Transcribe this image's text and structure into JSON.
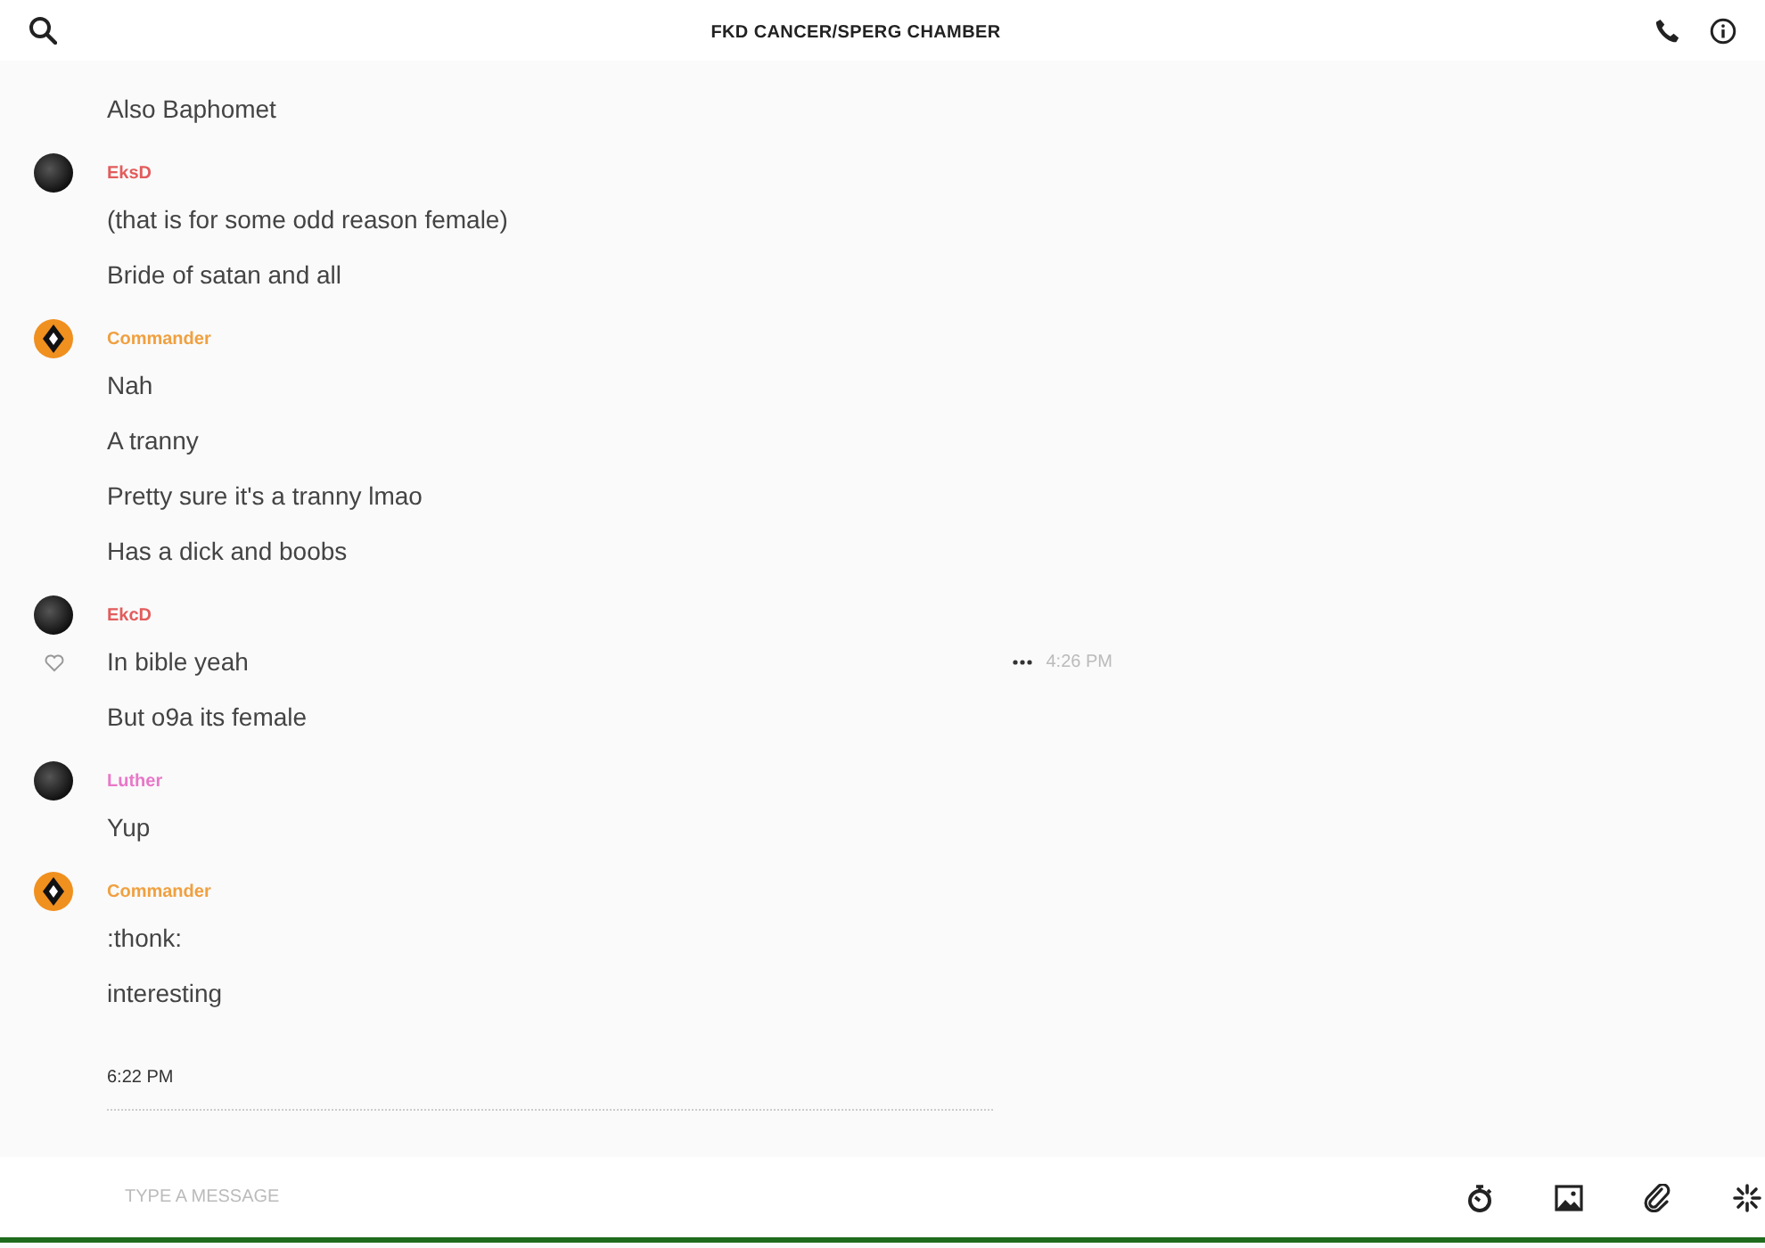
{
  "header": {
    "title": "FKD CANCER/SPERG CHAMBER"
  },
  "messages": [
    {
      "kind": "continuation",
      "lines": [
        {
          "text": "Also Baphomet",
          "hovered": false
        }
      ]
    },
    {
      "kind": "group",
      "author": "EksD",
      "color": "#e25c5c",
      "avatar": {
        "kind": "photo"
      },
      "lines": [
        {
          "text": "(that is for some odd reason female)",
          "hovered": false
        },
        {
          "text": "Bride of satan and all",
          "hovered": false
        }
      ]
    },
    {
      "kind": "group",
      "author": "Commander",
      "color": "#f0a040",
      "avatar": {
        "kind": "emblem"
      },
      "lines": [
        {
          "text": "Nah",
          "hovered": false
        },
        {
          "text": "A tranny",
          "hovered": false
        },
        {
          "text": "Pretty sure it's a tranny lmao",
          "hovered": false
        },
        {
          "text": "Has a dick and boobs",
          "hovered": false
        }
      ]
    },
    {
      "kind": "group",
      "author": "EkcD",
      "color": "#e25c5c",
      "avatar": {
        "kind": "photo"
      },
      "lines": [
        {
          "text": "In bible yeah",
          "hovered": true,
          "time": "4:26 PM"
        },
        {
          "text": "But o9a its female",
          "hovered": false
        }
      ]
    },
    {
      "kind": "group",
      "author": "Luther",
      "color": "#e878c8",
      "avatar": {
        "kind": "photo"
      },
      "lines": [
        {
          "text": "Yup",
          "hovered": false
        }
      ]
    },
    {
      "kind": "group",
      "author": "Commander",
      "color": "#f0a040",
      "avatar": {
        "kind": "emblem"
      },
      "lines": [
        {
          "text": ":thonk:",
          "hovered": false
        },
        {
          "text": "interesting",
          "hovered": false
        }
      ]
    },
    {
      "kind": "divider",
      "label": "6:22 PM"
    }
  ],
  "composer": {
    "placeholder": "TYPE A MESSAGE"
  }
}
